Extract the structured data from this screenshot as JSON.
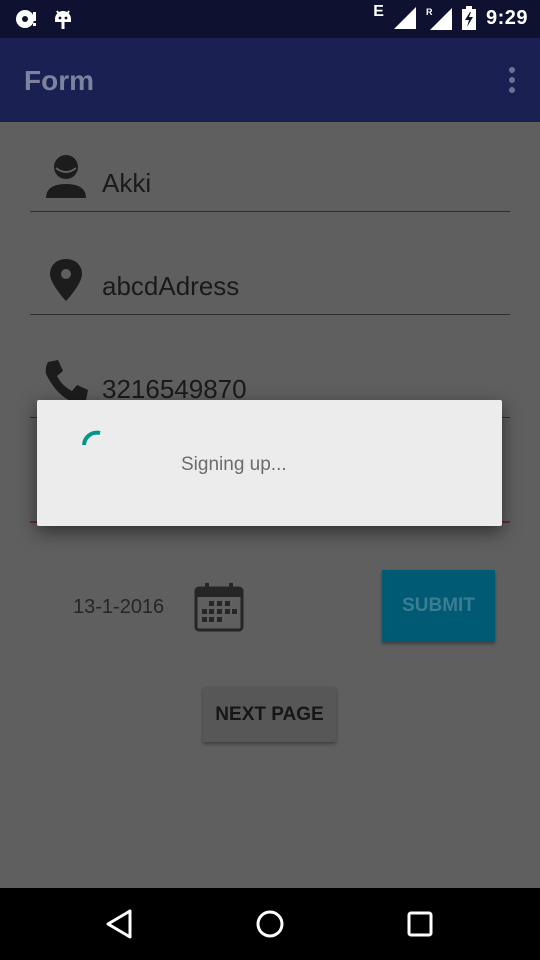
{
  "status_bar": {
    "time": "9:29",
    "network_letter": "E",
    "icons": [
      "sync-notification-icon",
      "android-debug-icon",
      "signal-icon",
      "roaming-signal-icon",
      "battery-charging-icon"
    ]
  },
  "app_bar": {
    "title": "Form",
    "overflow_icon": "more-vert-icon"
  },
  "form": {
    "name": {
      "value": "Akki",
      "icon": "person-icon"
    },
    "address": {
      "value": "abcdAdress",
      "icon": "location-pin-icon"
    },
    "phone": {
      "value": "3216549870",
      "icon": "phone-icon"
    },
    "date": {
      "value": "13-1-2016",
      "icon": "calendar-icon"
    },
    "submit_label": "SUBMIT",
    "next_page_label": "NEXT PAGE"
  },
  "dialog": {
    "message": "Signing up...",
    "spinner_color": "#009688"
  },
  "nav_bar": {
    "back_icon": "back-triangle-icon",
    "home_icon": "home-circle-icon",
    "recents_icon": "recents-square-icon"
  },
  "colors": {
    "app_bar": "#1a2052",
    "status_bar": "#0e1230",
    "submit_button": "#005a73",
    "accent": "#009688"
  }
}
